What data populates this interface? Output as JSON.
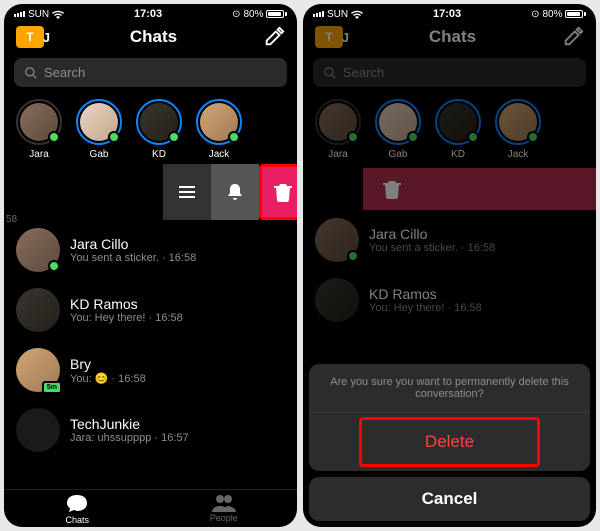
{
  "status": {
    "carrier": "SUN",
    "time": "17:03",
    "battery": "80%"
  },
  "header": {
    "title": "Chats"
  },
  "search": {
    "placeholder": "Search"
  },
  "stories": [
    {
      "name": "Jara",
      "active": false
    },
    {
      "name": "Gab",
      "active": true
    },
    {
      "name": "KD",
      "active": true
    },
    {
      "name": "Jack",
      "active": true
    }
  ],
  "swipe_timestamp": "58",
  "chats": [
    {
      "name": "Jara Cillo",
      "preview": "You sent a sticker.",
      "time": "16:58",
      "online": true
    },
    {
      "name": "KD Ramos",
      "preview": "You: Hey there!",
      "time": "16:58",
      "online": false
    },
    {
      "name": "Bry",
      "preview": "You: 😊",
      "time": "16:58",
      "badge": "5m"
    },
    {
      "name": "TechJunkie",
      "preview": "Jara: uhssupppp",
      "time": "16:57",
      "online": false
    }
  ],
  "tabs": {
    "chats": "Chats",
    "people": "People"
  },
  "sheet": {
    "message": "Are you sure you want to permanently delete this conversation?",
    "delete": "Delete",
    "cancel": "Cancel"
  }
}
